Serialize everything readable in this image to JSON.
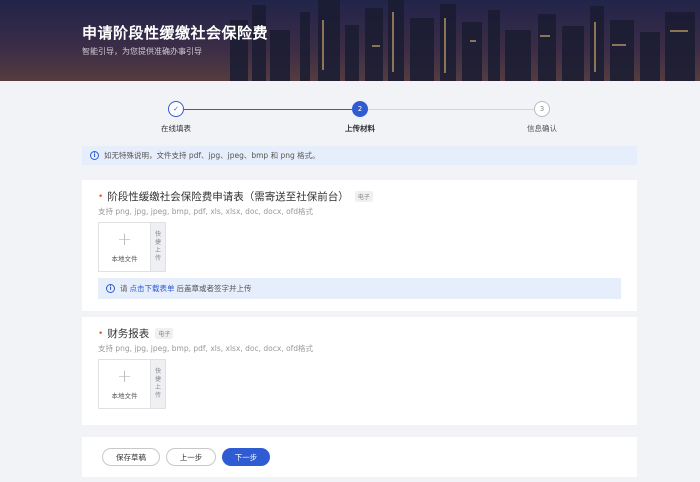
{
  "banner": {
    "title": "申请阶段性缓缴社会保险费",
    "subtitle": "智能引导，为您提供准确办事引导"
  },
  "steps": [
    {
      "number": "✓",
      "label": "在线填表",
      "state": "done"
    },
    {
      "number": "2",
      "label": "上传材料",
      "state": "active"
    },
    {
      "number": "3",
      "label": "信息确认",
      "state": "todo"
    }
  ],
  "notice": {
    "icon": "info-icon",
    "text": "如无特殊说明，文件支持 pdf、jpg、jpeg、bmp 和 png 格式。"
  },
  "materials": [
    {
      "title": "阶段性缓缴社会保险费申请表（需寄送至社保前台）",
      "tag": "电子",
      "formats": "支持 png, jpg, jpeg, bmp, pdf, xls, xlsx, doc, docx, ofd格式",
      "upload_label": "本地文件",
      "quick_label": "快捷上传",
      "hint_prefix": "请",
      "hint_link": "点击下载表单",
      "hint_suffix": "后盖章或者签字并上传"
    },
    {
      "title": "财务报表",
      "tag": "电子",
      "formats": "支持 png, jpg, jpeg, bmp, pdf, xls, xlsx, doc, docx, ofd格式",
      "upload_label": "本地文件",
      "quick_label": "快捷上传"
    }
  ],
  "footer": {
    "save_draft": "保存草稿",
    "prev": "上一步",
    "next": "下一步"
  },
  "colors": {
    "primary": "#2f5bd3",
    "required": "#e8623a",
    "info_bg": "#e6eefb"
  }
}
